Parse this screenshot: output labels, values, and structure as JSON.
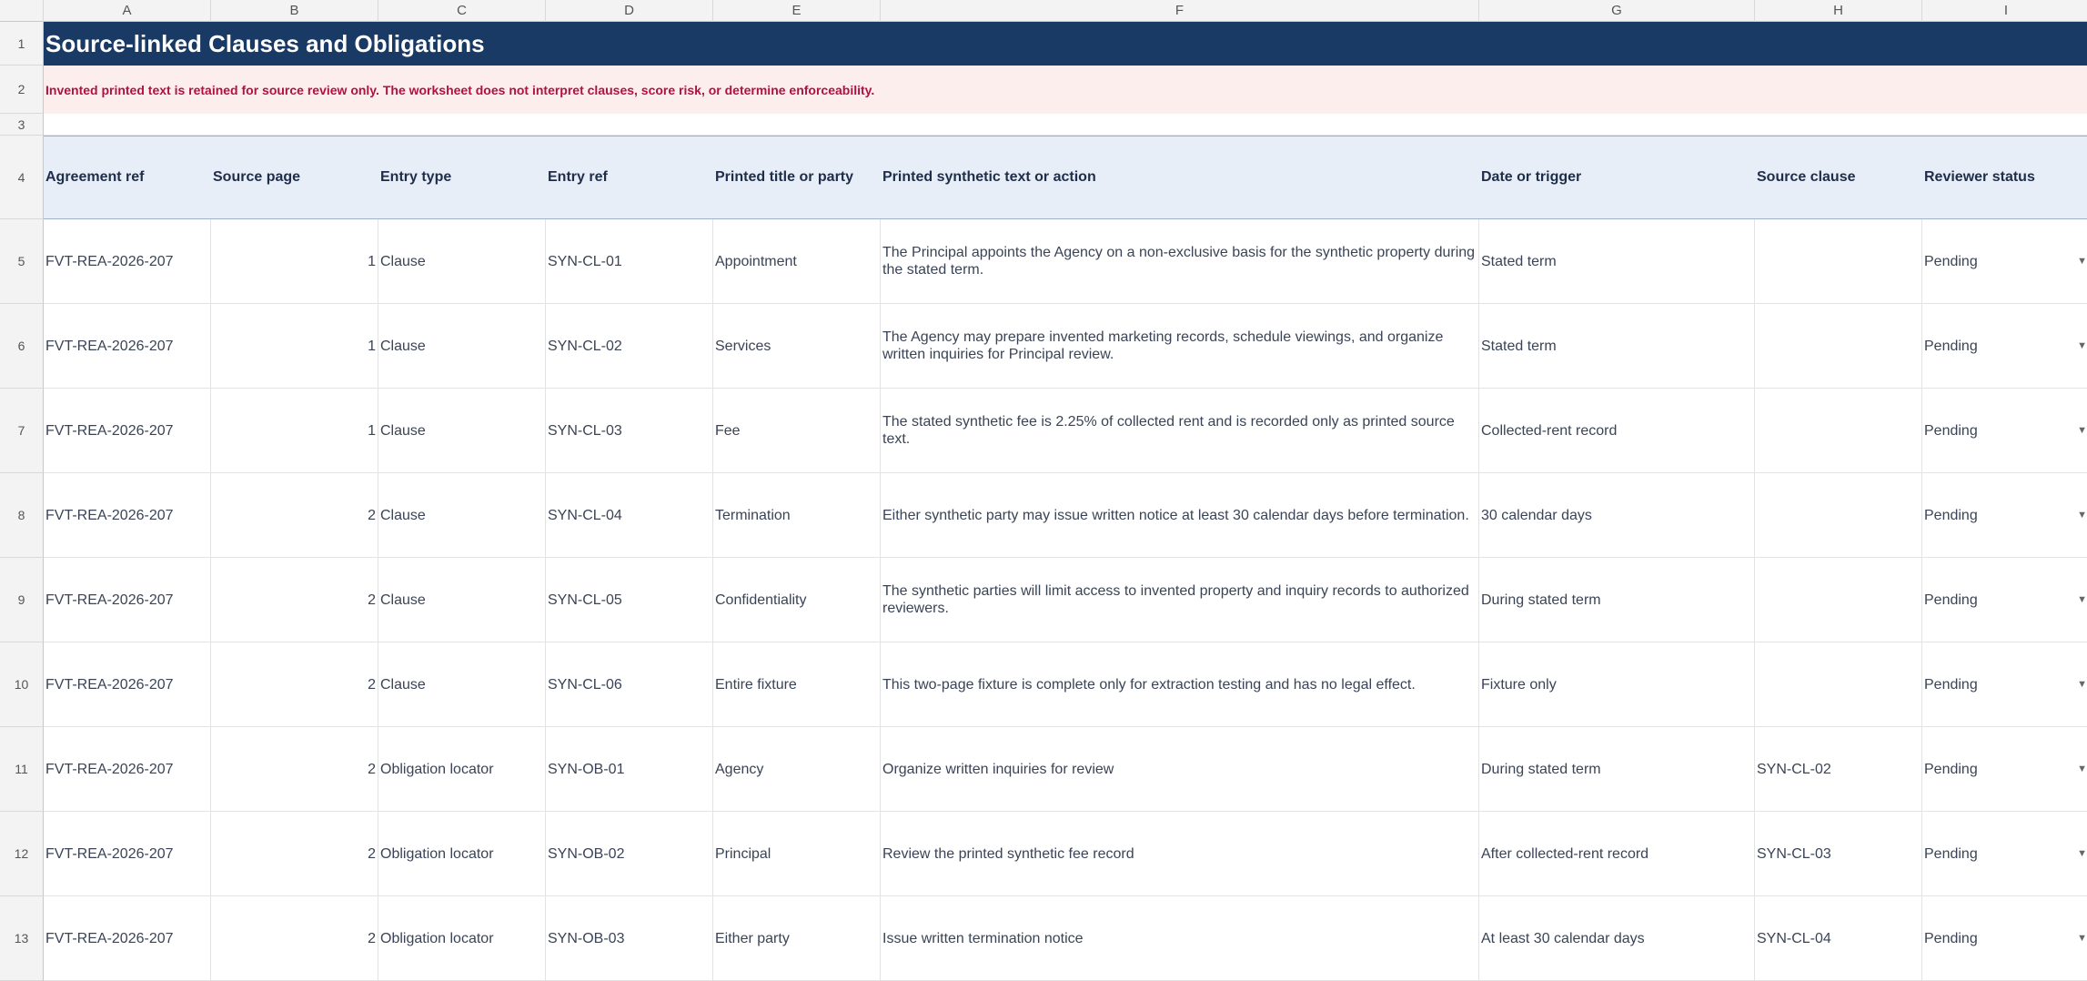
{
  "columns": [
    "A",
    "B",
    "C",
    "D",
    "E",
    "F",
    "G",
    "H",
    "I"
  ],
  "rows": {
    "title": {
      "num": "1",
      "text": "Source-linked Clauses and Obligations"
    },
    "note": {
      "num": "2",
      "text": "Invented printed text is retained for source review only. The worksheet does not interpret clauses, score risk, or determine enforceability."
    },
    "blank": {
      "num": "3"
    },
    "header": {
      "num": "4",
      "cells": [
        "Agreement ref",
        "Source page",
        "Entry type",
        "Entry ref",
        "Printed title or party",
        "Printed synthetic text or action",
        "Date or trigger",
        "Source clause",
        "Reviewer status"
      ]
    }
  },
  "data": [
    {
      "num": "5",
      "ref": "FVT-REA-2026-207",
      "page": "1",
      "type": "Clause",
      "entry": "SYN-CL-01",
      "title": "Appointment",
      "text": "The Principal appoints the Agency on a non-exclusive basis for the synthetic property during the stated term.",
      "trigger": "Stated term",
      "source": "",
      "status": "Pending"
    },
    {
      "num": "6",
      "ref": "FVT-REA-2026-207",
      "page": "1",
      "type": "Clause",
      "entry": "SYN-CL-02",
      "title": "Services",
      "text": "The Agency may prepare invented marketing records, schedule viewings, and organize written inquiries for Principal review.",
      "trigger": "Stated term",
      "source": "",
      "status": "Pending"
    },
    {
      "num": "7",
      "ref": "FVT-REA-2026-207",
      "page": "1",
      "type": "Clause",
      "entry": "SYN-CL-03",
      "title": "Fee",
      "text": "The stated synthetic fee is 2.25% of collected rent and is recorded only as printed source text.",
      "trigger": "Collected-rent record",
      "source": "",
      "status": "Pending"
    },
    {
      "num": "8",
      "ref": "FVT-REA-2026-207",
      "page": "2",
      "type": "Clause",
      "entry": "SYN-CL-04",
      "title": "Termination",
      "text": "Either synthetic party may issue written notice at least 30 calendar days before termination.",
      "trigger": "30 calendar days",
      "source": "",
      "status": "Pending"
    },
    {
      "num": "9",
      "ref": "FVT-REA-2026-207",
      "page": "2",
      "type": "Clause",
      "entry": "SYN-CL-05",
      "title": "Confidentiality",
      "text": "The synthetic parties will limit access to invented property and inquiry records to authorized reviewers.",
      "trigger": "During stated term",
      "source": "",
      "status": "Pending"
    },
    {
      "num": "10",
      "ref": "FVT-REA-2026-207",
      "page": "2",
      "type": "Clause",
      "entry": "SYN-CL-06",
      "title": "Entire fixture",
      "text": "This two-page fixture is complete only for extraction testing and has no legal effect.",
      "trigger": "Fixture only",
      "source": "",
      "status": "Pending"
    },
    {
      "num": "11",
      "ref": "FVT-REA-2026-207",
      "page": "2",
      "type": "Obligation locator",
      "entry": "SYN-OB-01",
      "title": "Agency",
      "text": "Organize written inquiries for review",
      "trigger": "During stated term",
      "source": "SYN-CL-02",
      "status": "Pending"
    },
    {
      "num": "12",
      "ref": "FVT-REA-2026-207",
      "page": "2",
      "type": "Obligation locator",
      "entry": "SYN-OB-02",
      "title": "Principal",
      "text": "Review the printed synthetic fee record",
      "trigger": "After collected-rent record",
      "source": "SYN-CL-03",
      "status": "Pending"
    },
    {
      "num": "13",
      "ref": "FVT-REA-2026-207",
      "page": "2",
      "type": "Obligation locator",
      "entry": "SYN-OB-03",
      "title": "Either party",
      "text": "Issue written termination notice",
      "trigger": "At least 30 calendar days",
      "source": "SYN-CL-04",
      "status": "Pending"
    }
  ],
  "icons": {
    "dropdown": "triangle-down-icon"
  }
}
